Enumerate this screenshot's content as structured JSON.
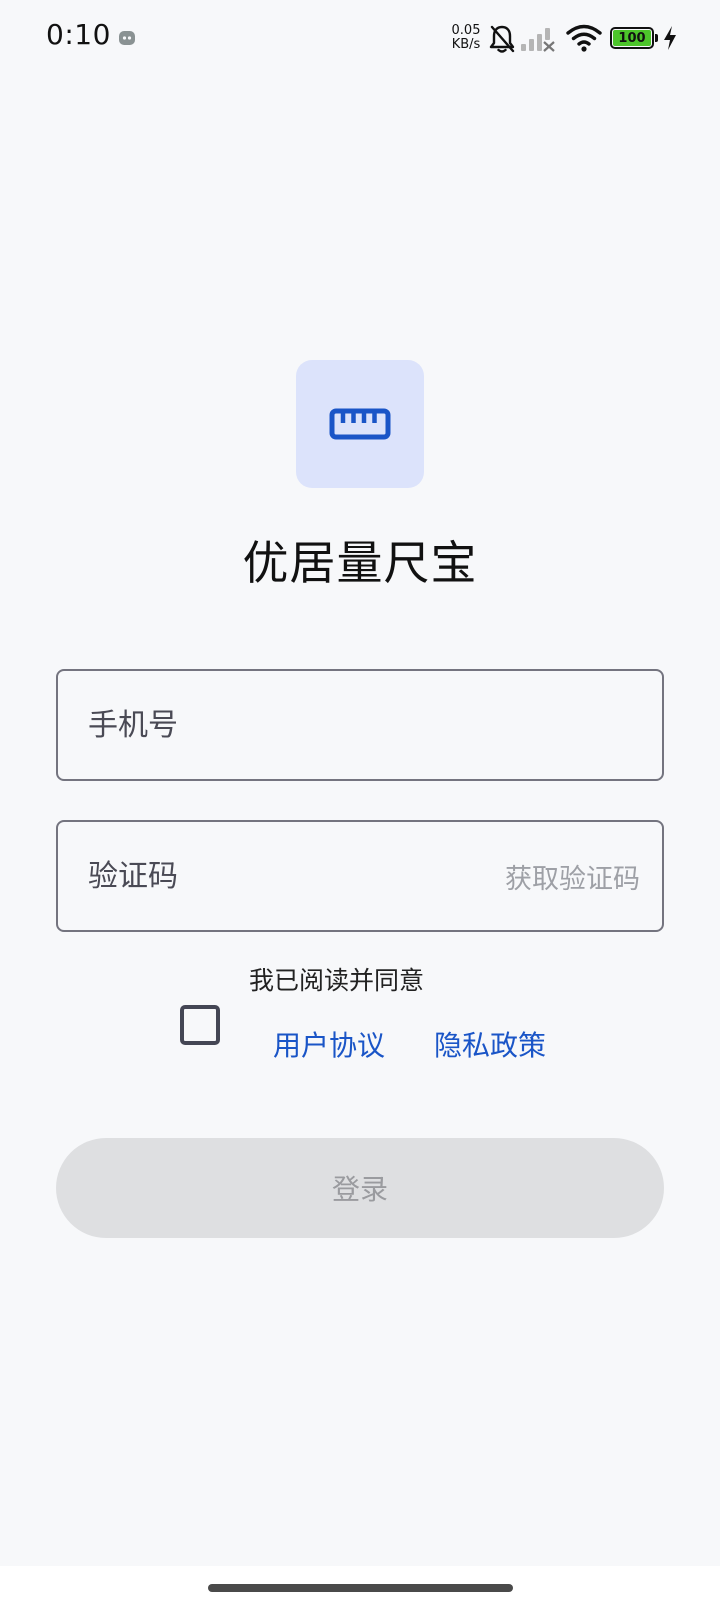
{
  "status_bar": {
    "time": "0:10",
    "net_speed_value": "0.05",
    "net_speed_unit": "KB/s",
    "battery_level": "100",
    "battery_color": "#4cc52a"
  },
  "app": {
    "title": "优居量尺宝",
    "logo_icon": "ruler-icon",
    "accent_color": "#1a55c7"
  },
  "form": {
    "phone_placeholder": "手机号",
    "phone_value": "",
    "code_placeholder": "验证码",
    "code_value": "",
    "get_code_label": "获取验证码"
  },
  "agreement": {
    "text": "我已阅读并同意",
    "checked": false,
    "user_agreement": "用户协议",
    "privacy_policy": "隐私政策"
  },
  "login": {
    "label": "登录",
    "enabled": false
  }
}
